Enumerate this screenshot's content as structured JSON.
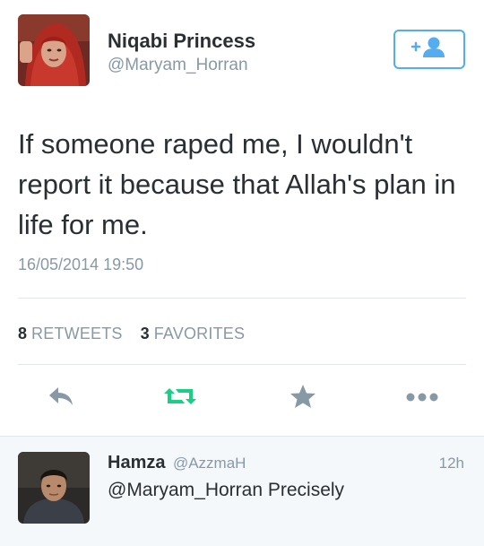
{
  "tweet": {
    "author_name": "Niqabi Princess",
    "author_handle": "@Maryam_Horran",
    "text": "If someone raped me, I wouldn't report it because that Allah's plan in life for me.",
    "timestamp": "16/05/2014 19:50",
    "retweets_count": "8",
    "retweets_label": "RETWEETS",
    "favorites_count": "3",
    "favorites_label": "FAVORITES"
  },
  "follow_button": {
    "icon": "follow-user-icon",
    "color": "#55acee"
  },
  "actions": [
    {
      "icon": "reply-icon",
      "color": "#8899a6"
    },
    {
      "icon": "retweet-icon",
      "color": "#19cf86"
    },
    {
      "icon": "favorite-star-icon",
      "color": "#8899a6"
    },
    {
      "icon": "more-icon",
      "color": "#8899a6"
    }
  ],
  "reply": {
    "name": "Hamza",
    "handle": "@AzzmaH",
    "time": "12h",
    "text": "@Maryam_Horran Precisely"
  }
}
